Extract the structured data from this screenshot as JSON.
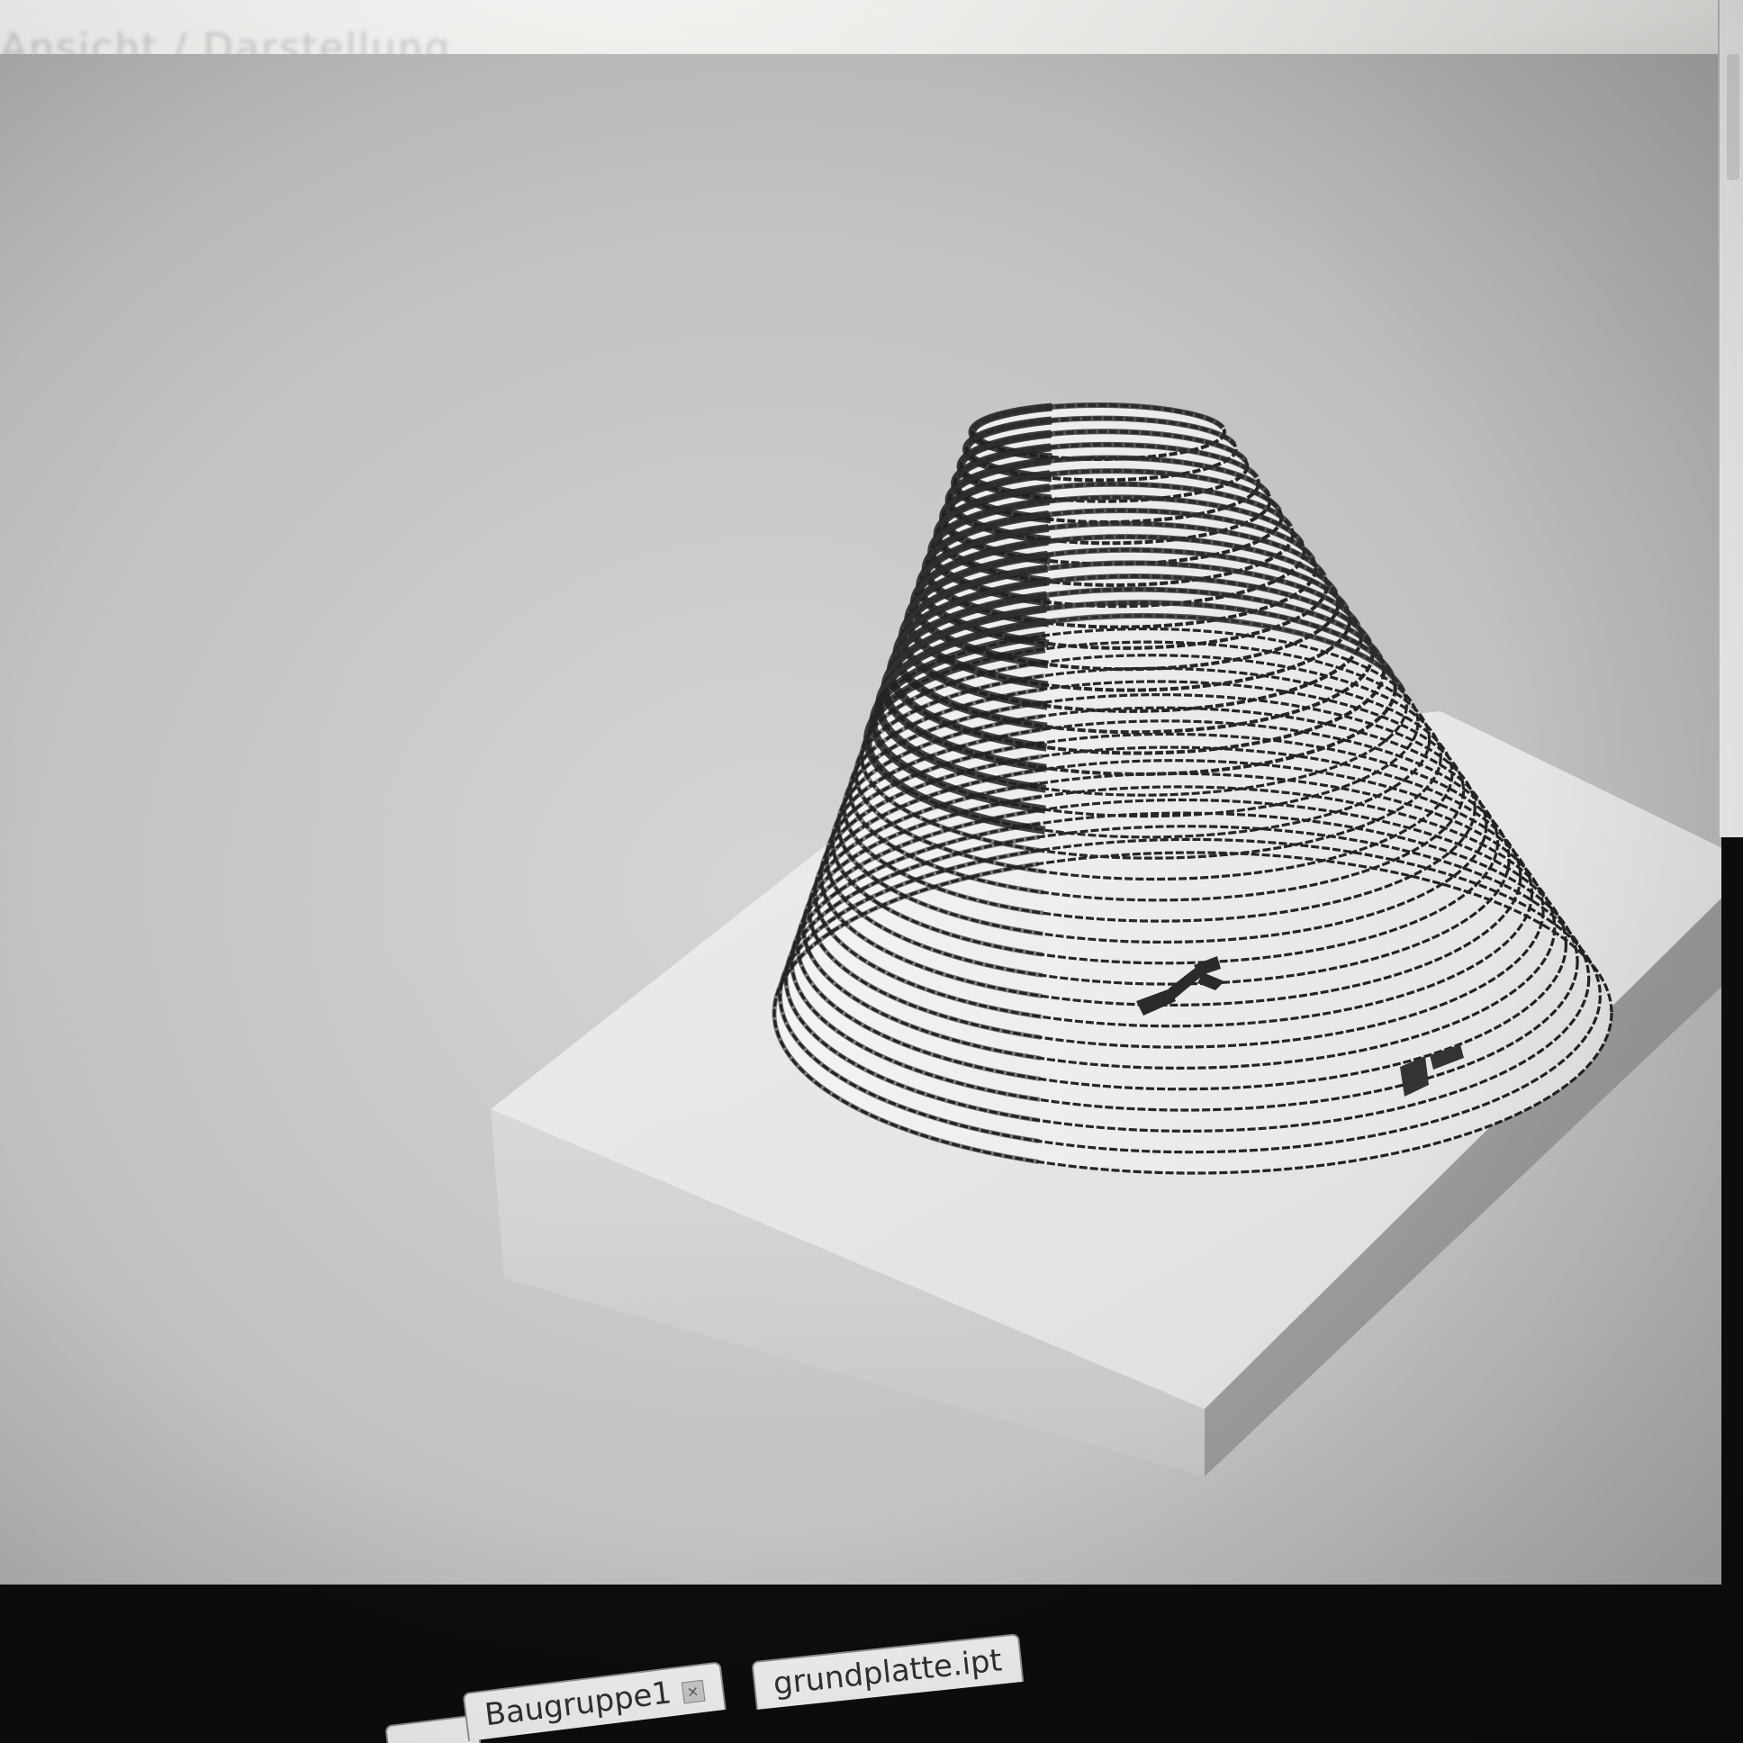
{
  "window": {
    "title": "Ansicht / Darstellung"
  },
  "document_tabs": [
    {
      "label": "Baugruppe1",
      "active": true
    },
    {
      "label": "grundplatte.ipt",
      "active": false
    }
  ],
  "model": {
    "body": "cone",
    "base": "plate",
    "cone_rendering": "stacked rings",
    "colors": {
      "background": "#c6c6c4",
      "plate_top": "#e7e7e5",
      "plate_front": "#d1d1cf",
      "plate_side": "#9b9b99",
      "cone_lines": "#222222"
    }
  },
  "icons": [
    "close-icon",
    "coordinate-triad-icon"
  ]
}
